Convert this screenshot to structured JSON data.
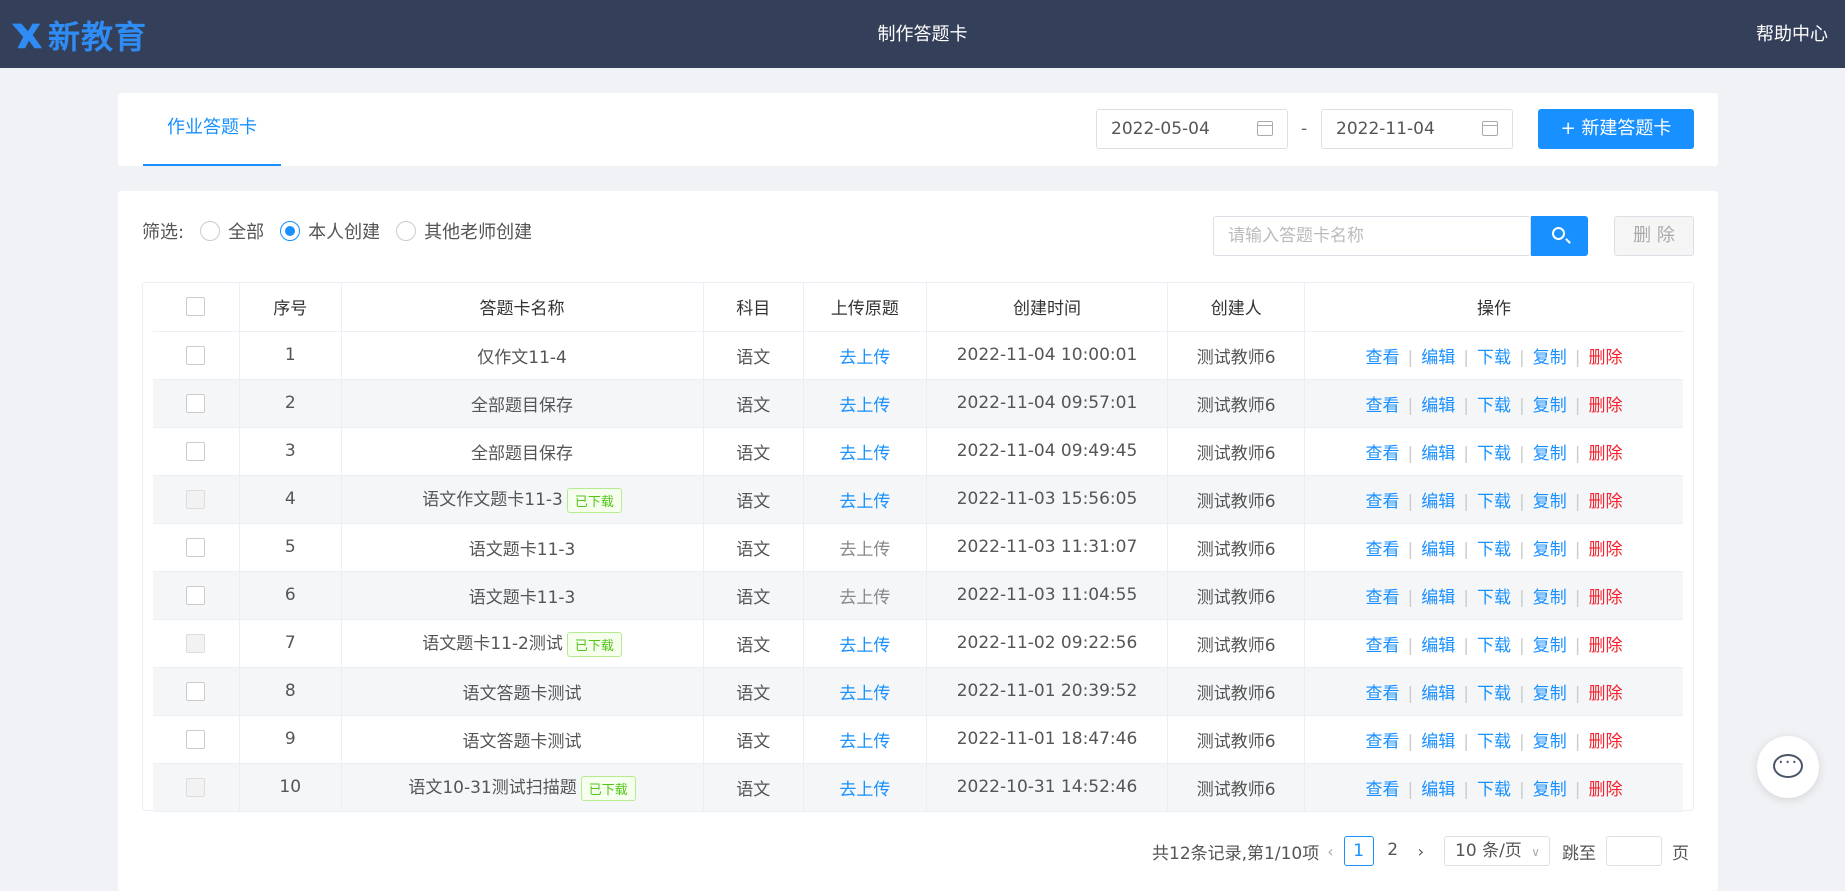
{
  "header": {
    "logo_text": "新教育",
    "title": "制作答题卡",
    "help": "帮助中心"
  },
  "toolbar": {
    "tab_label": "作业答题卡",
    "date_start": "2022-05-04",
    "date_end": "2022-11-04",
    "date_separator": "-",
    "new_button": "+ 新建答题卡"
  },
  "filter": {
    "label": "筛选:",
    "options": [
      "全部",
      "本人创建",
      "其他老师创建"
    ],
    "selected": "本人创建",
    "search_placeholder": "请输入答题卡名称",
    "delete_button": "删 除"
  },
  "table": {
    "columns": [
      "序号",
      "答题卡名称",
      "科目",
      "上传原题",
      "创建时间",
      "创建人",
      "操作"
    ],
    "actions": [
      "查看",
      "编辑",
      "下载",
      "复制",
      "删除"
    ],
    "rows": [
      {
        "no": "1",
        "name": "仅作文11-4",
        "badge": "",
        "subject": "语文",
        "upload": "去上传",
        "upload_disabled": false,
        "time": "2022-11-04 10:00:01",
        "creator": "测试教师6",
        "checkbox_disabled": false
      },
      {
        "no": "2",
        "name": "全部题目保存",
        "badge": "",
        "subject": "语文",
        "upload": "去上传",
        "upload_disabled": false,
        "time": "2022-11-04 09:57:01",
        "creator": "测试教师6",
        "checkbox_disabled": false
      },
      {
        "no": "3",
        "name": "全部题目保存",
        "badge": "",
        "subject": "语文",
        "upload": "去上传",
        "upload_disabled": false,
        "time": "2022-11-04 09:49:45",
        "creator": "测试教师6",
        "checkbox_disabled": false
      },
      {
        "no": "4",
        "name": "语文作文题卡11-3",
        "badge": "已下载",
        "subject": "语文",
        "upload": "去上传",
        "upload_disabled": false,
        "time": "2022-11-03 15:56:05",
        "creator": "测试教师6",
        "checkbox_disabled": true
      },
      {
        "no": "5",
        "name": "语文题卡11-3",
        "badge": "",
        "subject": "语文",
        "upload": "去上传",
        "upload_disabled": true,
        "time": "2022-11-03 11:31:07",
        "creator": "测试教师6",
        "checkbox_disabled": false
      },
      {
        "no": "6",
        "name": "语文题卡11-3",
        "badge": "",
        "subject": "语文",
        "upload": "去上传",
        "upload_disabled": true,
        "time": "2022-11-03 11:04:55",
        "creator": "测试教师6",
        "checkbox_disabled": false
      },
      {
        "no": "7",
        "name": "语文题卡11-2测试",
        "badge": "已下载",
        "subject": "语文",
        "upload": "去上传",
        "upload_disabled": false,
        "time": "2022-11-02 09:22:56",
        "creator": "测试教师6",
        "checkbox_disabled": true
      },
      {
        "no": "8",
        "name": "语文答题卡测试",
        "badge": "",
        "subject": "语文",
        "upload": "去上传",
        "upload_disabled": false,
        "time": "2022-11-01 20:39:52",
        "creator": "测试教师6",
        "checkbox_disabled": false
      },
      {
        "no": "9",
        "name": "语文答题卡测试",
        "badge": "",
        "subject": "语文",
        "upload": "去上传",
        "upload_disabled": false,
        "time": "2022-11-01 18:47:46",
        "creator": "测试教师6",
        "checkbox_disabled": false
      },
      {
        "no": "10",
        "name": "语文10-31测试扫描题",
        "badge": "已下载",
        "subject": "语文",
        "upload": "去上传",
        "upload_disabled": false,
        "time": "2022-10-31 14:52:46",
        "creator": "测试教师6",
        "checkbox_disabled": true
      }
    ]
  },
  "pagination": {
    "summary": "共12条记录,第1/10项",
    "pages": [
      "1",
      "2"
    ],
    "current": "1",
    "page_size": "10 条/页",
    "jump_label": "跳至",
    "jump_suffix": "页"
  },
  "colors": {
    "header_bg": "#344059",
    "primary": "#1890ff",
    "danger": "#f5222d",
    "success": "#52c41a"
  }
}
